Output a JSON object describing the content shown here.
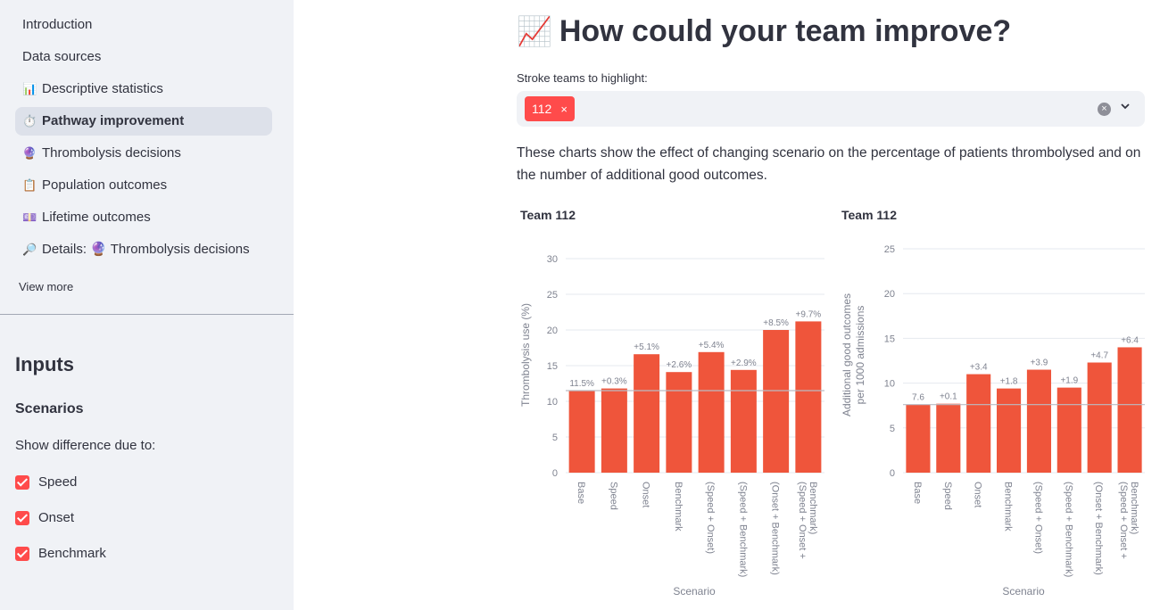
{
  "sidebar": {
    "nav": [
      {
        "icon": "",
        "label": "Introduction",
        "active": false
      },
      {
        "icon": "📊",
        "label": "Data sources",
        "active": false
      },
      {
        "icon": "📊",
        "label": "Descriptive statistics",
        "active": false
      },
      {
        "icon": "⏱️",
        "label": "Pathway improvement",
        "active": true
      },
      {
        "icon": "🔮",
        "label": "Thrombolysis decisions",
        "active": false
      },
      {
        "icon": "📋",
        "label": "Population outcomes",
        "active": false
      },
      {
        "icon": "💷",
        "label": "Lifetime outcomes",
        "active": false
      },
      {
        "icon": "🔎",
        "label": "Details: 🔮 Thrombolysis decisions",
        "active": false
      }
    ],
    "view_more": "View more",
    "inputs_heading": "Inputs",
    "scenarios_heading": "Scenarios",
    "show_diff_label": "Show difference due to:",
    "checkboxes": [
      {
        "label": "Speed",
        "checked": true
      },
      {
        "label": "Onset",
        "checked": true
      },
      {
        "label": "Benchmark",
        "checked": true
      }
    ]
  },
  "main": {
    "title_icon": "📈",
    "title": "How could your team improve?",
    "multiselect_label": "Stroke teams to highlight:",
    "selected_tag": "112",
    "tag_remove": "×",
    "clear_icon": "×",
    "description": "These charts show the effect of changing scenario on the percentage of patients thrombolysed and on the number of additional good outcomes."
  },
  "colors": {
    "accent": "#ff4b4b",
    "bar": "#ef553b",
    "sidebar_bg": "#f0f2f6"
  },
  "chart_data": [
    {
      "type": "bar",
      "title": "Team 112",
      "xlabel": "Scenario",
      "ylabel": "Thrombolysis use (%)",
      "ylim": [
        0,
        30
      ],
      "yticks": [
        0,
        5,
        10,
        15,
        20,
        25,
        30
      ],
      "categories": [
        "Base",
        "Speed",
        "Onset",
        "Benchmark",
        "(Speed + Onset)",
        "(Speed + Benchmark)",
        "(Onset + Benchmark)",
        "(Speed + Onset + Benchmark)"
      ],
      "values": [
        11.5,
        11.8,
        16.6,
        14.1,
        16.9,
        14.4,
        20.0,
        21.2
      ],
      "labels": [
        "11.5%",
        "+0.3%",
        "+5.1%",
        "+2.6%",
        "+5.4%",
        "+2.9%",
        "+8.5%",
        "+9.7%"
      ],
      "baseline": 11.5,
      "grid": true
    },
    {
      "type": "bar",
      "title": "Team 112",
      "xlabel": "Scenario",
      "ylabel": "Additional good outcomes per 1000 admissions",
      "ylim": [
        0,
        25
      ],
      "yticks": [
        0,
        5,
        10,
        15,
        20,
        25
      ],
      "categories": [
        "Base",
        "Speed",
        "Onset",
        "Benchmark",
        "(Speed + Onset)",
        "(Speed + Benchmark)",
        "(Onset + Benchmark)",
        "(Speed + Onset + Benchmark)"
      ],
      "values": [
        7.6,
        7.7,
        11.0,
        9.4,
        11.5,
        9.5,
        12.3,
        14.0
      ],
      "labels": [
        "7.6",
        "+0.1",
        "+3.4",
        "+1.8",
        "+3.9",
        "+1.9",
        "+4.7",
        "+6.4"
      ],
      "baseline": 7.6,
      "grid": true
    }
  ]
}
